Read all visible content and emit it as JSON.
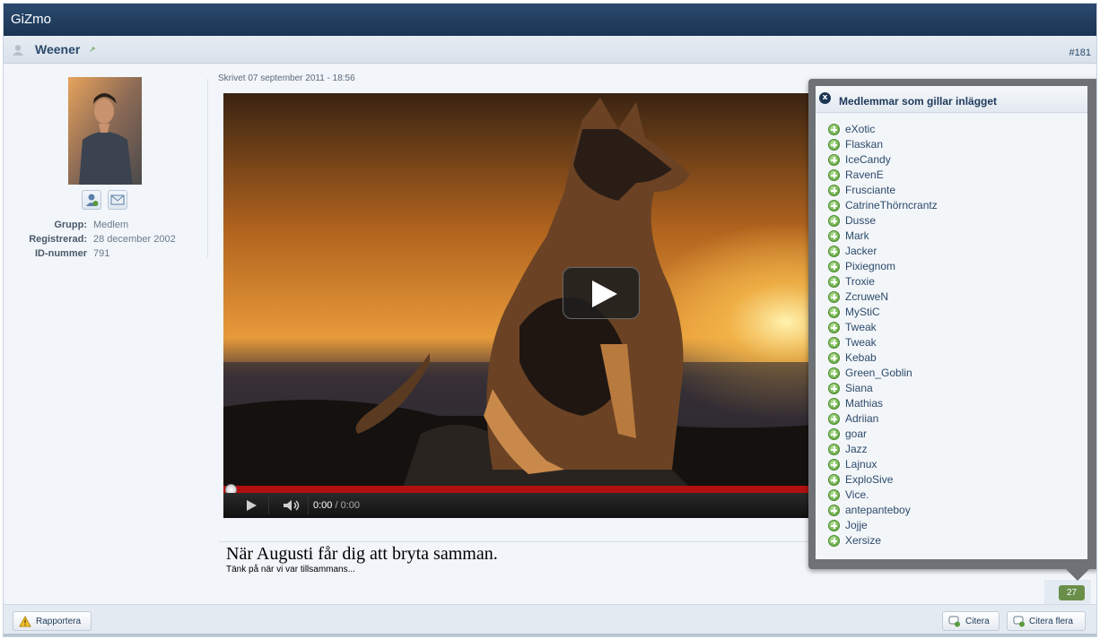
{
  "app": {
    "title": "GiZmo"
  },
  "post": {
    "author": "Weener",
    "post_number": "#181",
    "written": "Skrivet 07 september 2011 - 18:56",
    "caption_title": "När Augusti får dig att bryta samman.",
    "caption_sub": "Tänk på när vi var tillsammans..."
  },
  "profile": {
    "rows": [
      {
        "label": "Grupp:",
        "value": "Medlem"
      },
      {
        "label": "Registrerad:",
        "value": "28 december 2002"
      },
      {
        "label": "ID-nummer",
        "value": "791"
      }
    ]
  },
  "video": {
    "time_current": "0:00",
    "time_separator": " / ",
    "time_total": "0:00",
    "progress": 0
  },
  "likes": {
    "title": "Medlemmar som gillar inlägget",
    "close_label": "x",
    "count": "27",
    "members": [
      "eXotic",
      "Flaskan",
      "IceCandy",
      "RavenE",
      "Frusciante",
      "CatrineThörncrantz",
      "Dusse",
      "Mark",
      "Jacker",
      "Pixiegnom",
      "Troxie",
      "ZcruweN",
      "MyStiC",
      "Tweak",
      "Tweak",
      "Kebab",
      "Green_Goblin",
      "Siana",
      "Mathias",
      "Adriian",
      "goar",
      "Jazz",
      "Lajnux",
      "ExploSive",
      "Vice.",
      "antepanteboy",
      "Jojje",
      "Xersize"
    ]
  },
  "footer": {
    "report_label": "Rapportera",
    "quote_label": "Citera",
    "quote_multi_label": "Citera flera"
  },
  "colors": {
    "header": "#1b3553",
    "accent_green": "#6a8f4a",
    "progress_red": "#b01010"
  }
}
